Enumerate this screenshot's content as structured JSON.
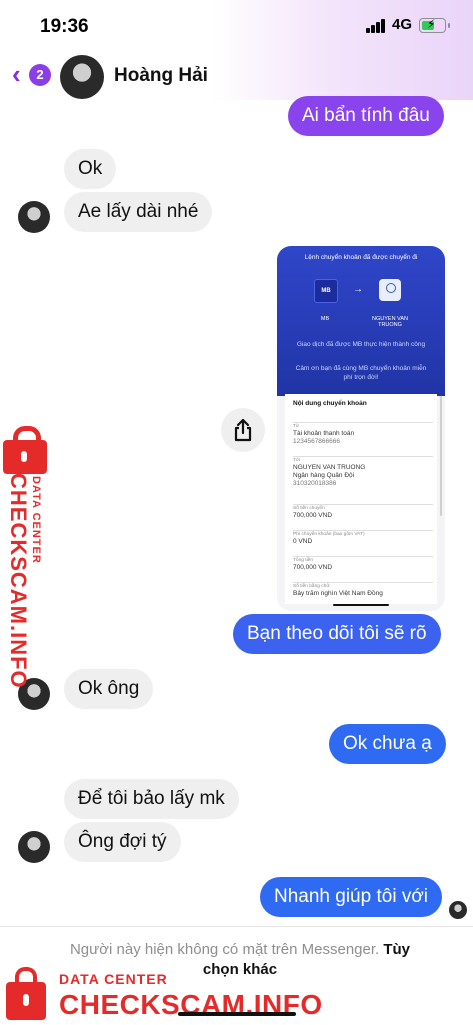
{
  "status_bar": {
    "time": "19:36",
    "network": "4G"
  },
  "header": {
    "back_badge": "2",
    "contact_name": "Hoàng Hải"
  },
  "messages": [
    {
      "side": "out",
      "text": "Ai bẩn tính đâu"
    },
    {
      "side": "in",
      "text": "Ok"
    },
    {
      "side": "in",
      "text": "Ae lấy dài nhé"
    },
    {
      "side": "out",
      "text": "Bạn theo dõi tôi sẽ rõ"
    },
    {
      "side": "in",
      "text": "Ok ông"
    },
    {
      "side": "out",
      "text": "Ok chưa ạ"
    },
    {
      "side": "in",
      "text": "Để tôi bảo lấy mk"
    },
    {
      "side": "in",
      "text": "Ông đợi tý"
    },
    {
      "side": "out",
      "text": "Nhanh giúp tôi với"
    }
  ],
  "receipt": {
    "title": "Lệnh chuyển khoản đã được chuyển đi",
    "bank_from": "MB",
    "bank_to": "NGUYEN VAN TRUONG",
    "msg1": "Giao dịch đã được MB thực hiện thành công",
    "msg2": "Cảm ơn bạn đã cùng MB chuyển khoản miễn phí trọn đời!",
    "section_title": "Nội dung chuyển khoản",
    "rows": [
      {
        "k": "Từ",
        "v": "Tài khoản thanh toán",
        "v2": "1234567866666"
      },
      {
        "k": "Tới",
        "v": "NGUYEN VAN TRUONG",
        "v2": "Ngân hàng Quân Đội",
        "v3": "310320018386"
      },
      {
        "k": "Số tiền chuyển",
        "v": "700,000 VND"
      },
      {
        "k": "Phí chuyển khoản (bao gồm VAT)",
        "v": "0 VND"
      },
      {
        "k": "Tổng tiền",
        "v": "700,000 VND"
      },
      {
        "k": "Số tiền bằng chữ",
        "v": "Bảy trăm nghìn Việt Nam Đồng"
      }
    ]
  },
  "footer": {
    "notice": "Người này hiện không có mặt trên Messenger.",
    "option": "Tùy chọn khác"
  },
  "watermark": {
    "small": "DATA CENTER",
    "big": "CHECKSCAM.INFO"
  },
  "colors": {
    "accent": "#8a3ee6",
    "out_bubble_top": "#8a46f0",
    "out_bubble_bottom": "#2f6bf2",
    "watermark": "#e52a2a"
  }
}
